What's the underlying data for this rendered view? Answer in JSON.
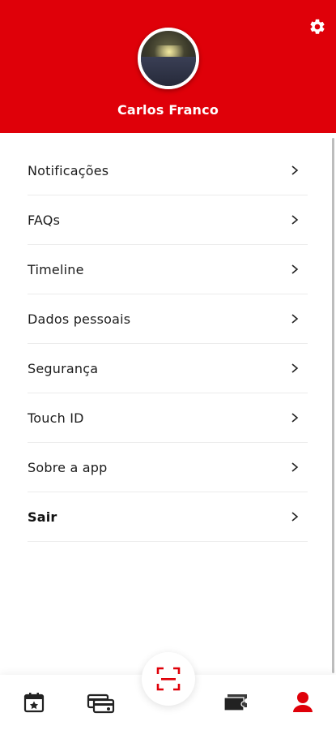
{
  "header": {
    "user_name": "Carlos Franco",
    "background_color": "#df0009",
    "settings_icon": "gear-icon"
  },
  "menu": {
    "items": [
      {
        "label": "Notificações"
      },
      {
        "label": "FAQs"
      },
      {
        "label": "Timeline"
      },
      {
        "label": "Dados pessoais"
      },
      {
        "label": "Segurança"
      },
      {
        "label": "Touch ID"
      },
      {
        "label": "Sobre a app"
      },
      {
        "label": "Sair"
      }
    ]
  },
  "bottom_nav": {
    "items": [
      {
        "icon": "calendar-star-icon"
      },
      {
        "icon": "cards-icon"
      },
      {
        "icon": "scan-icon"
      },
      {
        "icon": "tickets-icon"
      },
      {
        "icon": "profile-icon",
        "active": true
      }
    ],
    "accent_color": "#df0009"
  }
}
